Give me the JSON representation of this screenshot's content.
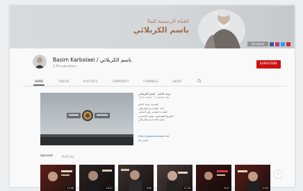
{
  "banner": {
    "title_line1": "القناة الرسمية للملا",
    "title_line2": "باسم الكربلائي",
    "link_label": "Facebook"
  },
  "channel": {
    "name": "Basim Karbalaei / باسم الكربلائي",
    "subscribers": "2.7M subscribers",
    "subscribe_label": "SUBSCRIBE"
  },
  "tabs": [
    "HOME",
    "VIDEOS",
    "PLAYLISTS",
    "COMMUNITY",
    "CHANNELS",
    "ABOUT"
  ],
  "featured": {
    "title": "نوحة الامام - باسم الكربلائي",
    "meta": "152K views · 3 weeks ago",
    "description": [
      "قصيدة: نوحة الامام",
      "أداء: الملا باسم الكربلائي",
      "كلمات: الشاعر علي الحتاني",
      "التوزيع الموسيقي: مهدي الحسيني",
      "انتاج: قناة باسم الكربلائي"
    ],
    "link": "http://www.karbalaei.net",
    "link2": "#البصيرة"
  },
  "uploads": {
    "title": "Uploads",
    "play_all": "PLAY ALL",
    "durations": [
      "13:46",
      "10:12",
      "9:05",
      "11:30",
      "8:47",
      "12:03"
    ]
  },
  "colors": {
    "subscribe": "#cc1111",
    "banner_text": "#a16a4a"
  }
}
